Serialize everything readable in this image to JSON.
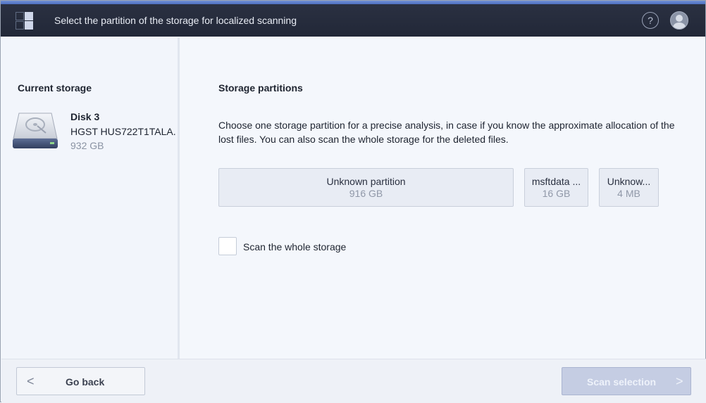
{
  "header": {
    "title": "Select the partition of the storage for localized scanning",
    "help_label": "?"
  },
  "sidebar": {
    "heading": "Current storage",
    "disk": {
      "name": "Disk 3",
      "model": "HGST HUS722T1TALA...",
      "size": "932 GB"
    }
  },
  "main": {
    "heading": "Storage partitions",
    "description": "Choose one storage partition for a precise analysis, in case if you know the approximate allocation of the lost files. You can also scan the whole storage for the deleted files.",
    "partitions": [
      {
        "name": "Unknown partition",
        "size": "916 GB"
      },
      {
        "name": "msftdata ...",
        "size": "16 GB"
      },
      {
        "name": "Unknow...",
        "size": "4 MB"
      }
    ],
    "scan_whole_label": "Scan the whole storage",
    "scan_whole_checked": false
  },
  "footer": {
    "back_label": "Go back",
    "back_chevron": "<",
    "scan_label": "Scan selection",
    "scan_chevron": ">"
  },
  "icons": {
    "menu": "grid-menu-icon",
    "help": "help-icon",
    "user": "user-icon",
    "disk": "hard-drive-icon"
  },
  "colors": {
    "topbar": "#262c3c",
    "accent": "#5a7dcc",
    "background": "#f2f5fb",
    "scan_button": "#c5cde3"
  }
}
